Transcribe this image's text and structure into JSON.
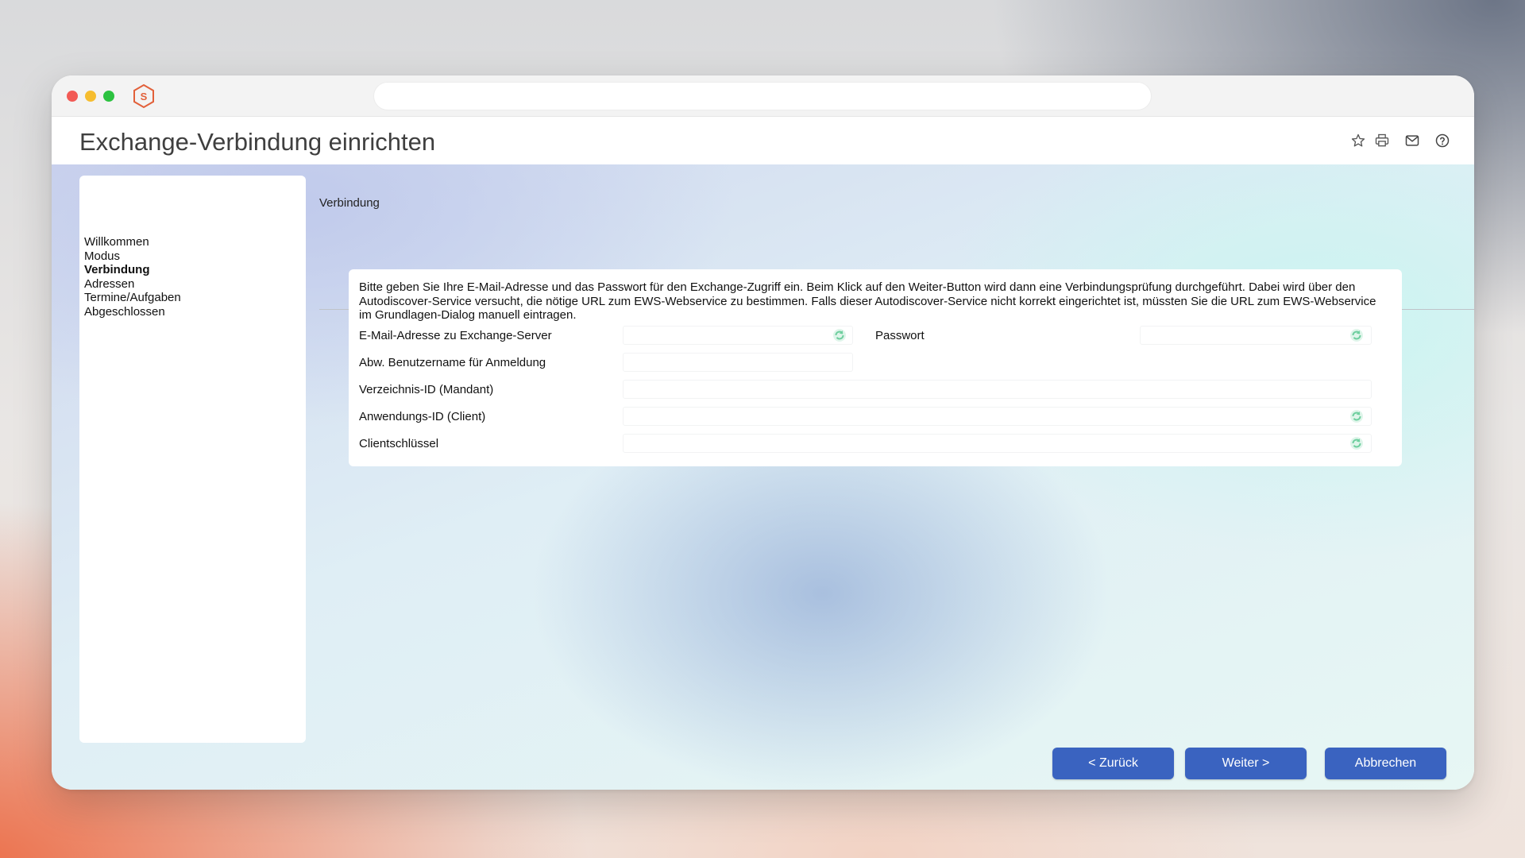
{
  "window": {
    "url": ""
  },
  "header": {
    "title": "Exchange-Verbindung einrichten",
    "icons": [
      "star-icon",
      "print-icon",
      "mail-icon",
      "help-icon"
    ]
  },
  "sidebar": {
    "items": [
      {
        "label": "Willkommen",
        "active": false
      },
      {
        "label": "Modus",
        "active": false
      },
      {
        "label": "Verbindung",
        "active": true
      },
      {
        "label": "Adressen",
        "active": false
      },
      {
        "label": "Termine/Aufgaben",
        "active": false
      },
      {
        "label": "Abgeschlossen",
        "active": false
      }
    ]
  },
  "main": {
    "section_title": "Verbindung",
    "intro": "Bitte geben Sie Ihre E-Mail-Adresse und das Passwort für den Exchange-Zugriff ein. Beim Klick auf den Weiter-Button wird dann eine Verbindungsprüfung durchgeführt. Dabei wird über den Autodiscover-Service versucht, die nötige URL zum EWS-Webservice zu bestimmen. Falls dieser Autodiscover-Service nicht korrekt eingerichtet ist, müssten Sie die URL zum EWS-Webservice im Grundlagen-Dialog manuell eintragen.",
    "fields": {
      "email_label": "E-Mail-Adresse zu Exchange-Server",
      "email_value": "",
      "password_label": "Passwort",
      "password_value": "",
      "username_label": "Abw. Benutzername für Anmeldung",
      "username_value": "",
      "tenant_label": "Verzeichnis-ID (Mandant)",
      "tenant_value": "",
      "client_label": "Anwendungs-ID (Client)",
      "client_value": "",
      "secret_label": "Clientschlüssel",
      "secret_value": ""
    }
  },
  "footer": {
    "back_label": "< Zurück",
    "next_label": "Weiter >",
    "cancel_label": "Abbrechen"
  },
  "colors": {
    "button": "#3a63c0",
    "field_icon": "#8fd3b0",
    "logo": "#e2603a"
  }
}
